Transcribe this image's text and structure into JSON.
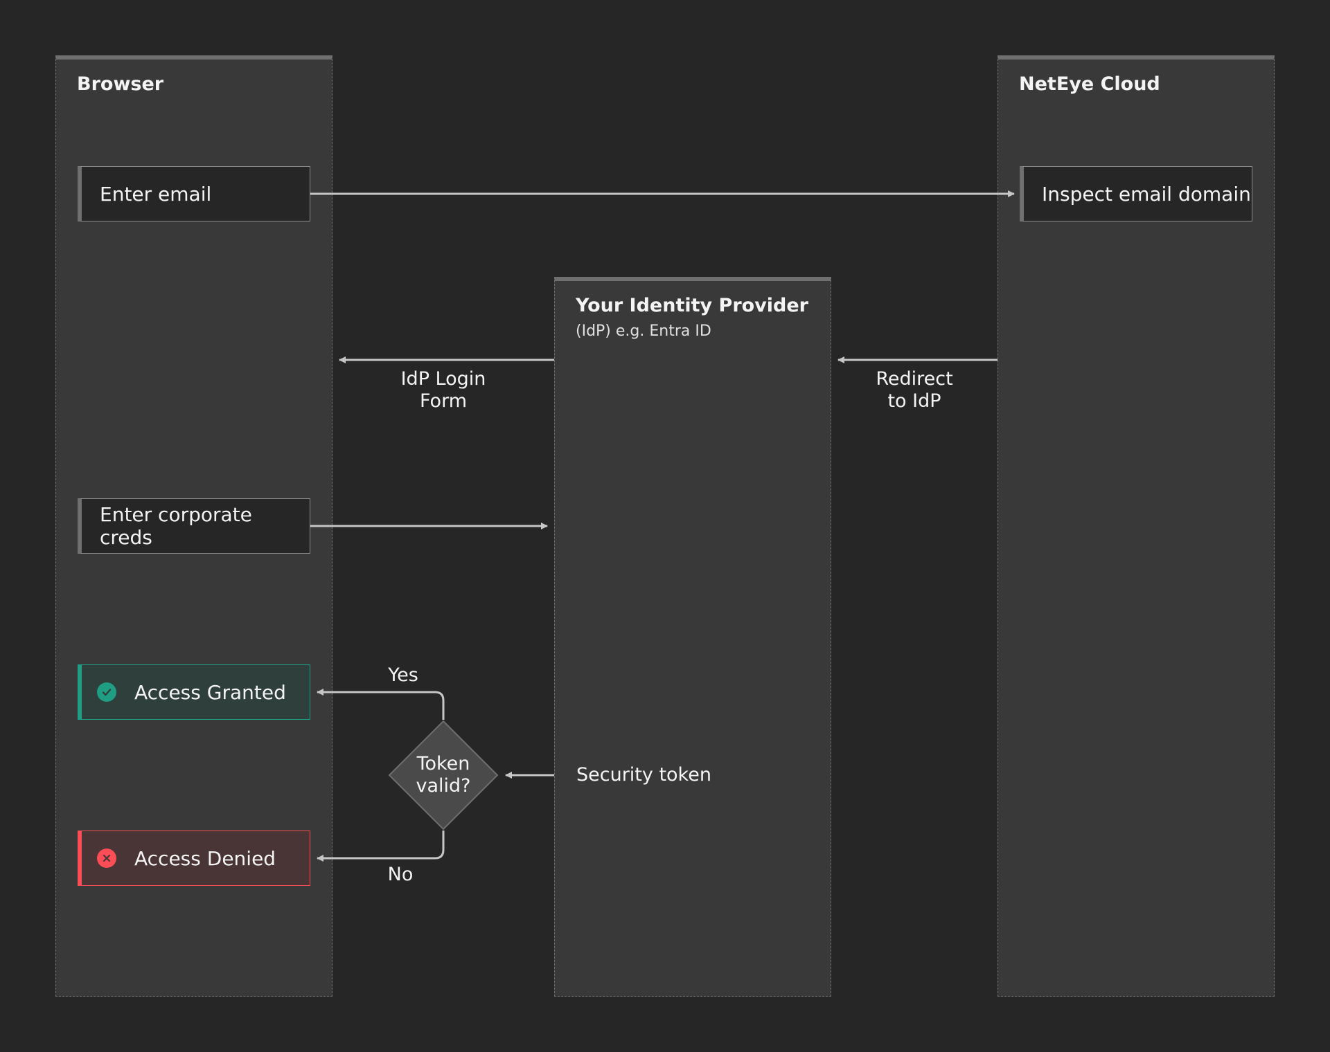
{
  "lanes": {
    "browser": {
      "title": "Browser"
    },
    "idp": {
      "title": "Your Identity Provider",
      "subtitle": "(IdP) e.g. Entra ID"
    },
    "cloud": {
      "title": "NetEye Cloud"
    }
  },
  "steps": {
    "enter_email": "Enter email",
    "inspect_domain": "Inspect email domain",
    "enter_creds": "Enter corporate creds",
    "access_granted": "Access Granted",
    "access_denied": "Access Denied",
    "security_token": "Security token"
  },
  "decision": {
    "line1": "Token",
    "line2": "valid?"
  },
  "edges": {
    "idp_login_line1": "IdP Login",
    "idp_login_line2": "Form",
    "redirect_line1": "Redirect",
    "redirect_line2": "to IdP",
    "yes": "Yes",
    "no": "No"
  },
  "colors": {
    "background": "#262626",
    "lane": "#393939",
    "granted": "#1f9e84",
    "denied": "#fa4d56",
    "arrow": "#c6c6c6"
  },
  "icons": {
    "granted": "checkmark-filled-icon",
    "denied": "error-filled-icon"
  }
}
